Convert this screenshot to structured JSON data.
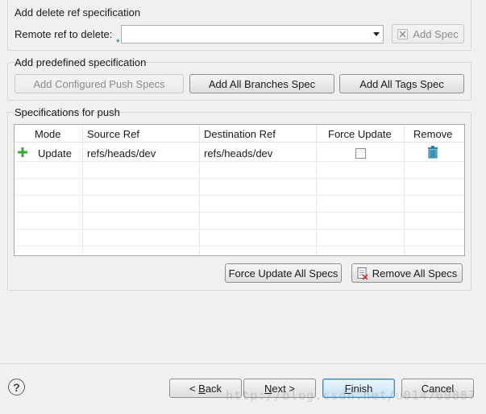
{
  "delete_ref": {
    "title": "Add delete ref specification",
    "remote_label": "Remote ref to delete:",
    "required_mark": "*",
    "remote_value": "",
    "add_spec_label": "Add Spec"
  },
  "predefined": {
    "title": "Add predefined specification",
    "configured_label": "Add Configured Push Specs",
    "branches_label": "Add All Branches Spec",
    "tags_label": "Add All Tags Spec"
  },
  "specs": {
    "title": "Specifications for push",
    "columns": [
      "Mode",
      "Source Ref",
      "Destination Ref",
      "Force Update",
      "Remove"
    ],
    "rows": [
      {
        "mode": "Update",
        "source": "refs/heads/dev",
        "destination": "refs/heads/dev",
        "force": false
      }
    ],
    "force_all_label": "Force Update All Specs",
    "remove_all_label": "Remove All Specs"
  },
  "footer": {
    "help_glyph": "?",
    "back_underlined": "B",
    "back_rest": "ack",
    "back_prefix": "< ",
    "next_underlined": "N",
    "next_rest": "ext >",
    "finish_underlined": "F",
    "finish_rest": "inish",
    "cancel_label": "Cancel"
  },
  "watermark": "http://blog.csdn.net/u014769887",
  "colors": {
    "accent": "#3c7fb1",
    "add_icon": "#3aa935",
    "trash_icon": "#2a7fa8"
  }
}
